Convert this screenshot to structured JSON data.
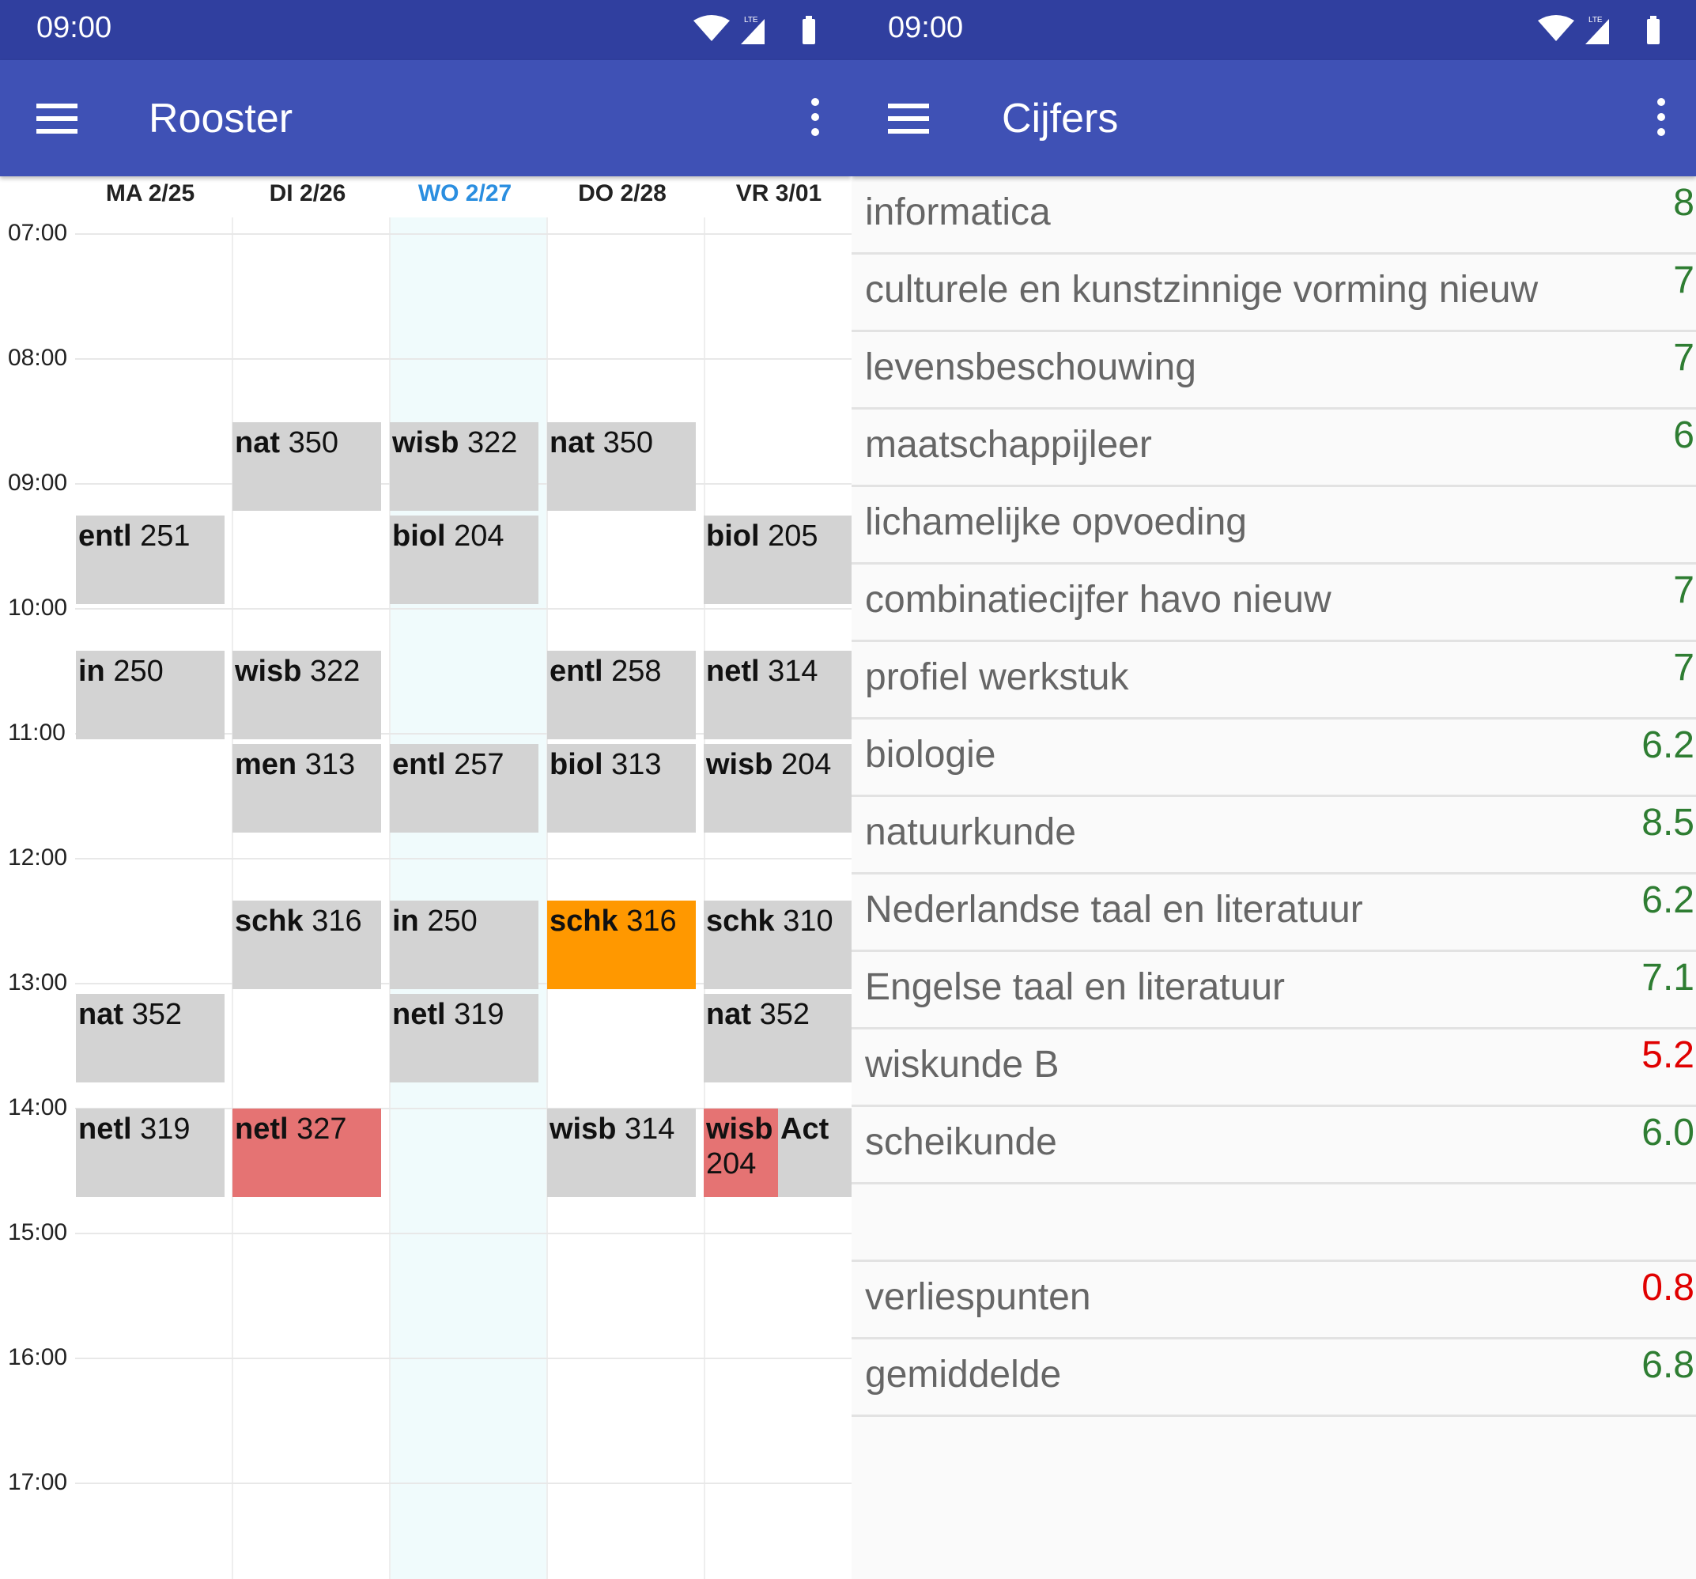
{
  "left": {
    "status_time": "09:00",
    "title": "Rooster",
    "days": [
      "MA 2/25",
      "DI 2/26",
      "WO 2/27",
      "DO 2/28",
      "VR 3/01"
    ],
    "today_index": 2,
    "times": [
      "07:00",
      "08:00",
      "09:00",
      "10:00",
      "11:00",
      "12:00",
      "13:00",
      "14:00",
      "15:00",
      "16:00",
      "17:00"
    ],
    "lessons": [
      {
        "subject": "nat",
        "room": "350"
      },
      {
        "subject": "wisb",
        "room": "322"
      },
      {
        "subject": "nat",
        "room": "350"
      },
      {
        "subject": "entl",
        "room": "251"
      },
      {
        "subject": "biol",
        "room": "204"
      },
      {
        "subject": "biol",
        "room": "205"
      },
      {
        "subject": "in",
        "room": "250"
      },
      {
        "subject": "wisb",
        "room": "322"
      },
      {
        "subject": "entl",
        "room": "258"
      },
      {
        "subject": "netl",
        "room": "314"
      },
      {
        "subject": "men",
        "room": "313"
      },
      {
        "subject": "entl",
        "room": "257"
      },
      {
        "subject": "biol",
        "room": "313"
      },
      {
        "subject": "wisb",
        "room": "204"
      },
      {
        "subject": "schk",
        "room": "316"
      },
      {
        "subject": "in",
        "room": "250"
      },
      {
        "subject": "schk",
        "room": "316"
      },
      {
        "subject": "schk",
        "room": "310"
      },
      {
        "subject": "nat",
        "room": "352"
      },
      {
        "subject": "netl",
        "room": "319"
      },
      {
        "subject": "nat",
        "room": "352"
      },
      {
        "subject": "netl",
        "room": "319"
      },
      {
        "subject": "netl",
        "room": "327"
      },
      {
        "subject": "wisb",
        "room": "314"
      },
      {
        "subject": "wisb",
        "room": "204",
        "extra": "Act"
      }
    ]
  },
  "right": {
    "status_time": "09:00",
    "title": "Cijfers",
    "grades": [
      {
        "name": "informatica",
        "value": "8"
      },
      {
        "name": "culturele en kunstzinnige vorming nieuw",
        "value": "7"
      },
      {
        "name": "levensbeschouwing",
        "value": "7"
      },
      {
        "name": "maatschappijleer",
        "value": "6"
      },
      {
        "name": "lichamelijke opvoeding",
        "value": ""
      },
      {
        "name": "combinatiecijfer havo nieuw",
        "value": "7"
      },
      {
        "name": "profiel werkstuk",
        "value": "7"
      },
      {
        "name": "biologie",
        "value": "6.2"
      },
      {
        "name": "natuurkunde",
        "value": "8.5"
      },
      {
        "name": "Nederlandse taal en literatuur",
        "value": "6.2"
      },
      {
        "name": "Engelse taal en literatuur",
        "value": "7.1"
      },
      {
        "name": "wiskunde B",
        "value": "5.2"
      },
      {
        "name": "scheikunde",
        "value": "6.0"
      },
      {
        "name": "",
        "value": ""
      },
      {
        "name": "verliespunten",
        "value": "0.8"
      },
      {
        "name": "gemiddelde",
        "value": "6.8"
      }
    ]
  },
  "colors": {
    "status_bar": "#303f9f",
    "app_bar": "#3f51b5",
    "good_grade": "#2e7d32",
    "bad_grade": "#e00000",
    "highlight_lesson": "#ff9800",
    "changed_lesson": "#e57373"
  }
}
